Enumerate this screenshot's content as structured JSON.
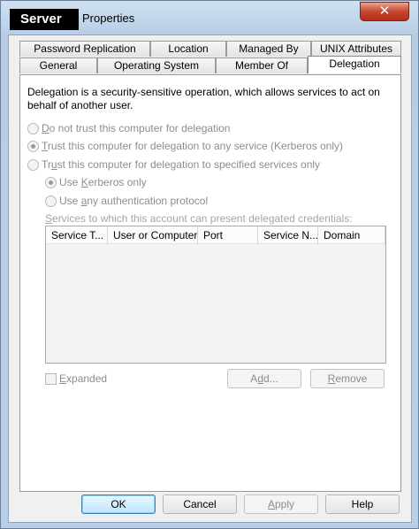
{
  "window": {
    "title_server": "Server",
    "title_properties": "Properties",
    "close_glyph": "✕"
  },
  "tabs": {
    "row1": [
      "Password Replication",
      "Location",
      "Managed By",
      "UNIX Attributes"
    ],
    "row2": [
      "General",
      "Operating System",
      "Member Of",
      "Delegation"
    ],
    "active": "Delegation"
  },
  "delegation": {
    "description": "Delegation is a security-sensitive operation, which allows services to act on behalf of another user.",
    "options": [
      {
        "pre": "",
        "key": "D",
        "post": "o not trust this computer for delegation",
        "checked": false
      },
      {
        "pre": "",
        "key": "T",
        "post": "rust this computer for delegation to any service (Kerberos only)",
        "checked": true
      },
      {
        "pre": "Tr",
        "key": "u",
        "post": "st this computer for delegation to specified services only",
        "checked": false
      }
    ],
    "sub_options": [
      {
        "pre": "Use ",
        "key": "K",
        "post": "erberos only",
        "checked": true
      },
      {
        "pre": "Use ",
        "key": "a",
        "post": "ny authentication protocol",
        "checked": false
      }
    ],
    "services_caption_pre": "",
    "services_caption_key": "S",
    "services_caption_post": "ervices to which this account can present delegated credentials:",
    "columns": [
      "Service T...",
      "User or Computer",
      "Port",
      "Service N...",
      "Domain"
    ],
    "expanded_key": "E",
    "expanded_post": "xpanded",
    "add_pre": "A",
    "add_key": "d",
    "add_post": "d...",
    "remove_key": "R",
    "remove_post": "emove"
  },
  "footer": {
    "ok": "OK",
    "cancel": "Cancel",
    "apply_key": "A",
    "apply_post": "pply",
    "help": "Help"
  }
}
